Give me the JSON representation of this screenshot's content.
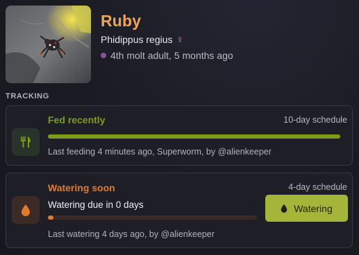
{
  "pet": {
    "name": "Ruby",
    "species": "Phidippus regius",
    "sex_icon": "female-sign-icon",
    "molt_status": "4th molt adult, 5 months ago",
    "status_dot_color": "#8a4fa0",
    "photo_icon": "jumping-spider-photo"
  },
  "tracking": {
    "section_label": "TRACKING",
    "feeding": {
      "title": "Fed recently",
      "schedule": "10-day schedule",
      "progress_fraction": 1.0,
      "last_text": "Last feeding 4 minutes ago, Superworm, by @alienkeeper",
      "icon": "fork-knife-icon",
      "accent": "#7b9d1b"
    },
    "watering": {
      "title": "Watering soon",
      "schedule": "4-day schedule",
      "due_text": "Watering due in 0 days",
      "progress_fraction": 0.0,
      "last_text": "Last watering 4 days ago, by @alienkeeper",
      "icon": "water-drop-icon",
      "accent": "#e07a2f",
      "button_label": "Watering",
      "button_icon": "water-drop-icon",
      "button_color": "#a4b53a"
    }
  }
}
